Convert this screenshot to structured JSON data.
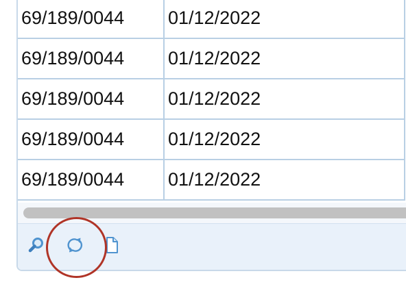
{
  "grid": {
    "rows": [
      {
        "code": "69/189/0044",
        "date": "01/12/2022"
      },
      {
        "code": "69/189/0044",
        "date": "01/12/2022"
      },
      {
        "code": "69/189/0044",
        "date": "01/12/2022"
      },
      {
        "code": "69/189/0044",
        "date": "01/12/2022"
      },
      {
        "code": "69/189/0044",
        "date": "01/12/2022"
      }
    ]
  },
  "pager": {
    "buttons": [
      {
        "icon": "search-icon"
      },
      {
        "icon": "refresh-icon"
      },
      {
        "icon": "document-icon"
      }
    ]
  },
  "colors": {
    "grid_border": "#b8cfe4",
    "pager_background": "#e9f1fa",
    "icon_blue": "#4f93cf",
    "highlight_ring": "#b03427"
  }
}
